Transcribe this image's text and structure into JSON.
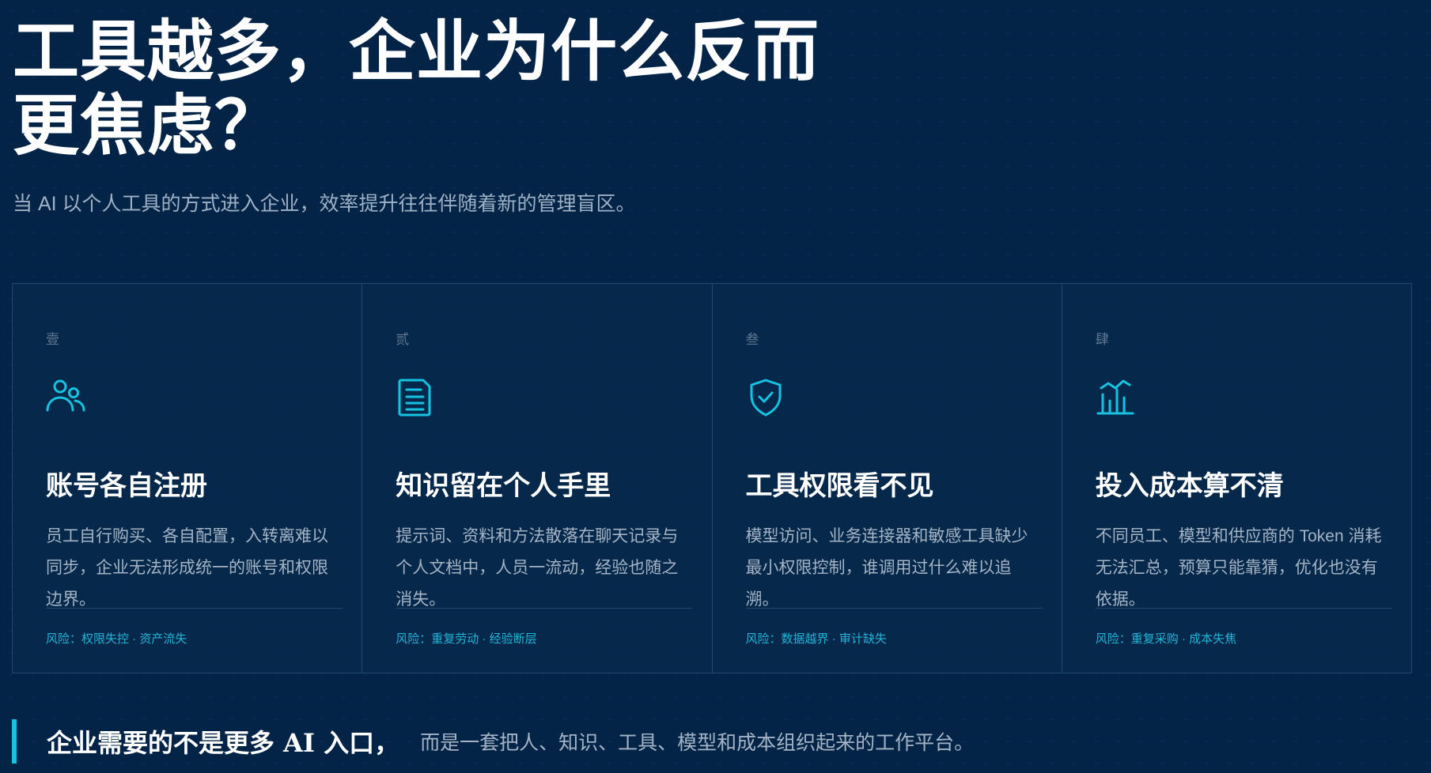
{
  "hero": {
    "title": "工具越多，企业为什么反而更焦虑？",
    "subtitle": "当 AI 以个人工具的方式进入企业，效率提升往往伴随着新的管理盲区。"
  },
  "cards": [
    {
      "index": "壹",
      "icon": "users-icon",
      "title": "账号各自注册",
      "description": "员工自行购买、各自配置，入转离难以同步，企业无法形成统一的账号和权限边界。",
      "risk": "风险：权限失控 · 资产流失"
    },
    {
      "index": "贰",
      "icon": "document-icon",
      "title": "知识留在个人手里",
      "description": "提示词、资料和方法散落在聊天记录与个人文档中，人员一流动，经验也随之消失。",
      "risk": "风险：重复劳动 · 经验断层"
    },
    {
      "index": "叁",
      "icon": "shield-check-icon",
      "title": "工具权限看不见",
      "description": "模型访问、业务连接器和敏感工具缺少最小权限控制，谁调用过什么难以追溯。",
      "risk": "风险：数据越界 · 审计缺失"
    },
    {
      "index": "肆",
      "icon": "chart-bars-icon",
      "title": "投入成本算不清",
      "description": "不同员工、模型和供应商的 Token 消耗无法汇总，预算只能靠猜，优化也没有依据。",
      "risk": "风险：重复采购 · 成本失焦"
    }
  ],
  "callout": {
    "strong": "企业需要的不是更多 AI 入口，",
    "rest": "而是一套把人、知识、工具、模型和成本组织起来的工作平台。"
  },
  "colors": {
    "background": "#032447",
    "accent": "#16c3e0",
    "risk": "#22b4d6"
  }
}
